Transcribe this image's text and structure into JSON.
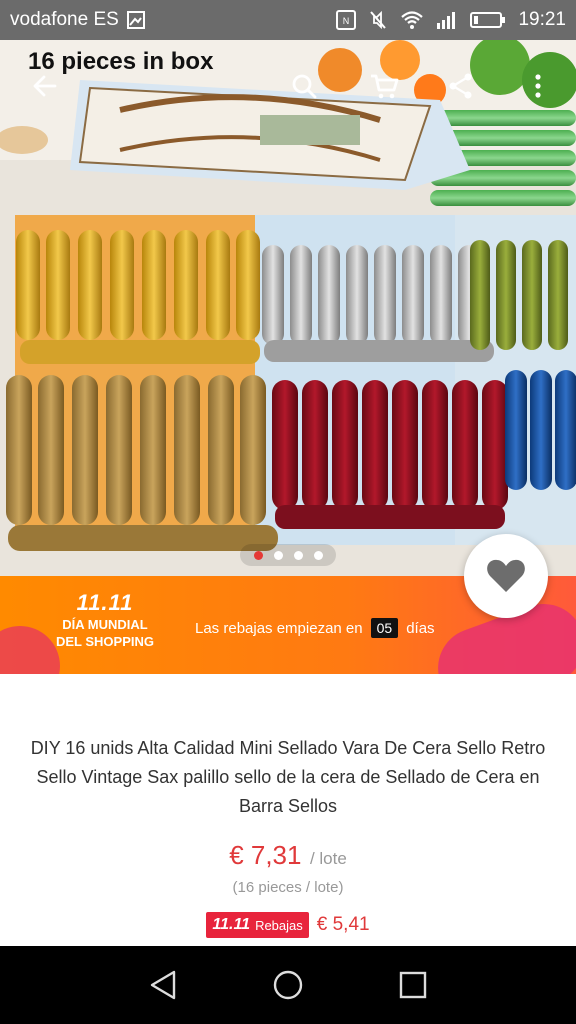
{
  "status": {
    "carrier": "vodafone ES",
    "time": "19:21",
    "icons": [
      "image-icon",
      "nfc-icon",
      "mute-icon",
      "wifi-icon",
      "signal-icon",
      "battery-icon"
    ]
  },
  "header": {
    "overlay_title": "16 pieces in box",
    "icons": [
      "back-arrow-icon",
      "search-icon",
      "cart-icon",
      "share-icon",
      "more-icon"
    ]
  },
  "gallery": {
    "current": 1,
    "total": 4
  },
  "banner": {
    "logo_number": "11.11",
    "logo_line1": "DÍA MUNDIAL",
    "logo_line2": "DEL SHOPPING",
    "text_before": "Las rebajas empiezan en",
    "days": "05",
    "text_after": "días",
    "colors": {
      "start": "#ff8a00",
      "end": "#ff5a3a",
      "accent": "#e8336e"
    }
  },
  "product": {
    "title": "DIY 16 unids Alta Calidad Mini Sellado Vara De Cera Sello Retro Sello Vintage Sax palillo sello de la cera de Sellado de Cera en Barra Sellos",
    "price": "€ 7,31",
    "price_unit": "/ lote",
    "pieces": "(16 pieces / lote)",
    "sale_tag_number": "11.11",
    "sale_tag_label": "Rebajas",
    "sale_price": "€ 5,41",
    "colors": {
      "price": "#e0393a",
      "sale_tag": "#e8243c"
    }
  },
  "navbar": {
    "icons": [
      "back-triangle-icon",
      "home-circle-icon",
      "recents-square-icon"
    ]
  }
}
